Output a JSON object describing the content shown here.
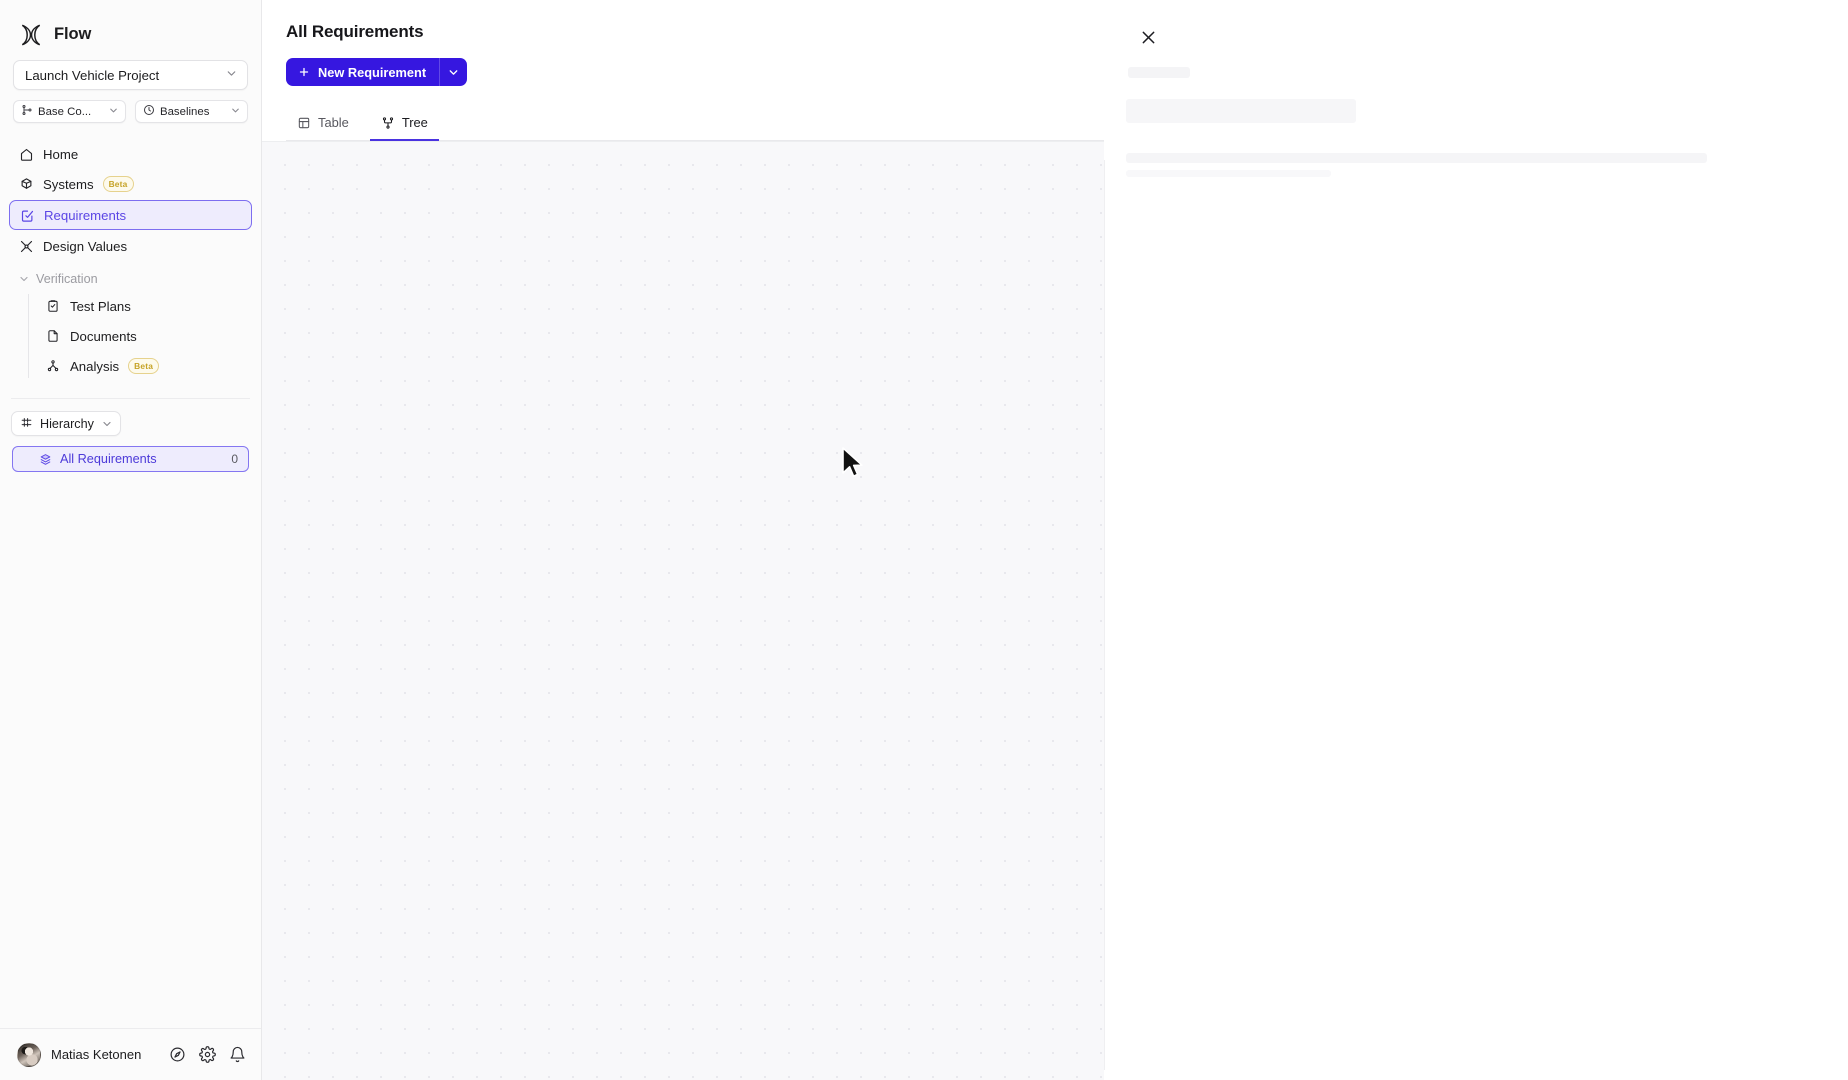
{
  "brand": {
    "name": "Flow",
    "logo_icon": "flow-logo-icon"
  },
  "sidebar": {
    "project_selector": {
      "value": "Launch Vehicle Project",
      "caret_icon": "chevron-down-icon"
    },
    "chips": [
      {
        "label": "Base Co...",
        "icon": "branch-icon",
        "caret_icon": "chevron-down-icon"
      },
      {
        "label": "Baselines",
        "icon": "history-clock-icon",
        "caret_icon": "chevron-down-icon"
      }
    ],
    "nav": [
      {
        "label": "Home",
        "icon": "home-icon",
        "active": false,
        "badge": ""
      },
      {
        "label": "Systems",
        "icon": "system-cube-icon",
        "active": false,
        "badge": "Beta"
      },
      {
        "label": "Requirements",
        "icon": "requirement-check-icon",
        "active": true,
        "badge": ""
      },
      {
        "label": "Design Values",
        "icon": "design-values-icon",
        "active": false,
        "badge": ""
      }
    ],
    "group": {
      "label": "Verification",
      "chevron_icon": "chevron-down-icon",
      "items": [
        {
          "label": "Test Plans",
          "icon": "clipboard-check-icon",
          "badge": ""
        },
        {
          "label": "Documents",
          "icon": "document-icon",
          "badge": ""
        },
        {
          "label": "Analysis",
          "icon": "analysis-node-icon",
          "badge": "Beta"
        }
      ]
    },
    "hierarchy": {
      "button_label": "Hierarchy",
      "button_icon": "hierarchy-grid-icon",
      "button_caret_icon": "chevron-down-icon",
      "items": [
        {
          "label": "All Requirements",
          "icon": "stack-layers-icon",
          "count": "0",
          "active": true
        }
      ]
    },
    "user": {
      "name": "Matias Ketonen",
      "avatar_icon": "user-avatar",
      "actions": [
        {
          "icon": "compass-icon",
          "name": "compass-button"
        },
        {
          "icon": "gear-icon",
          "name": "settings-button"
        },
        {
          "icon": "bell-icon",
          "name": "notifications-button"
        }
      ]
    }
  },
  "main": {
    "page_title": "All Requirements",
    "new_button": {
      "label": "New Requirement",
      "plus_icon": "plus-icon",
      "caret_icon": "chevron-down-icon"
    },
    "tabs": [
      {
        "label": "Table",
        "icon": "table-icon",
        "active": false
      },
      {
        "label": "Tree",
        "icon": "tree-branch-icon",
        "active": true
      }
    ],
    "canvas": {
      "name": "requirements-tree-canvas",
      "cursor_icon": "mouse-pointer-cursor"
    }
  },
  "right_panel": {
    "close_icon": "close-icon",
    "loading": true
  },
  "colors": {
    "accent": "#3617e0",
    "accent_soft": "#eeecfd",
    "accent_border": "#7d6ef0",
    "beta_text": "#c6a327",
    "beta_border": "#e6d28d",
    "canvas_bg": "#f8f8fa",
    "canvas_dot": "#e3e3e9"
  }
}
